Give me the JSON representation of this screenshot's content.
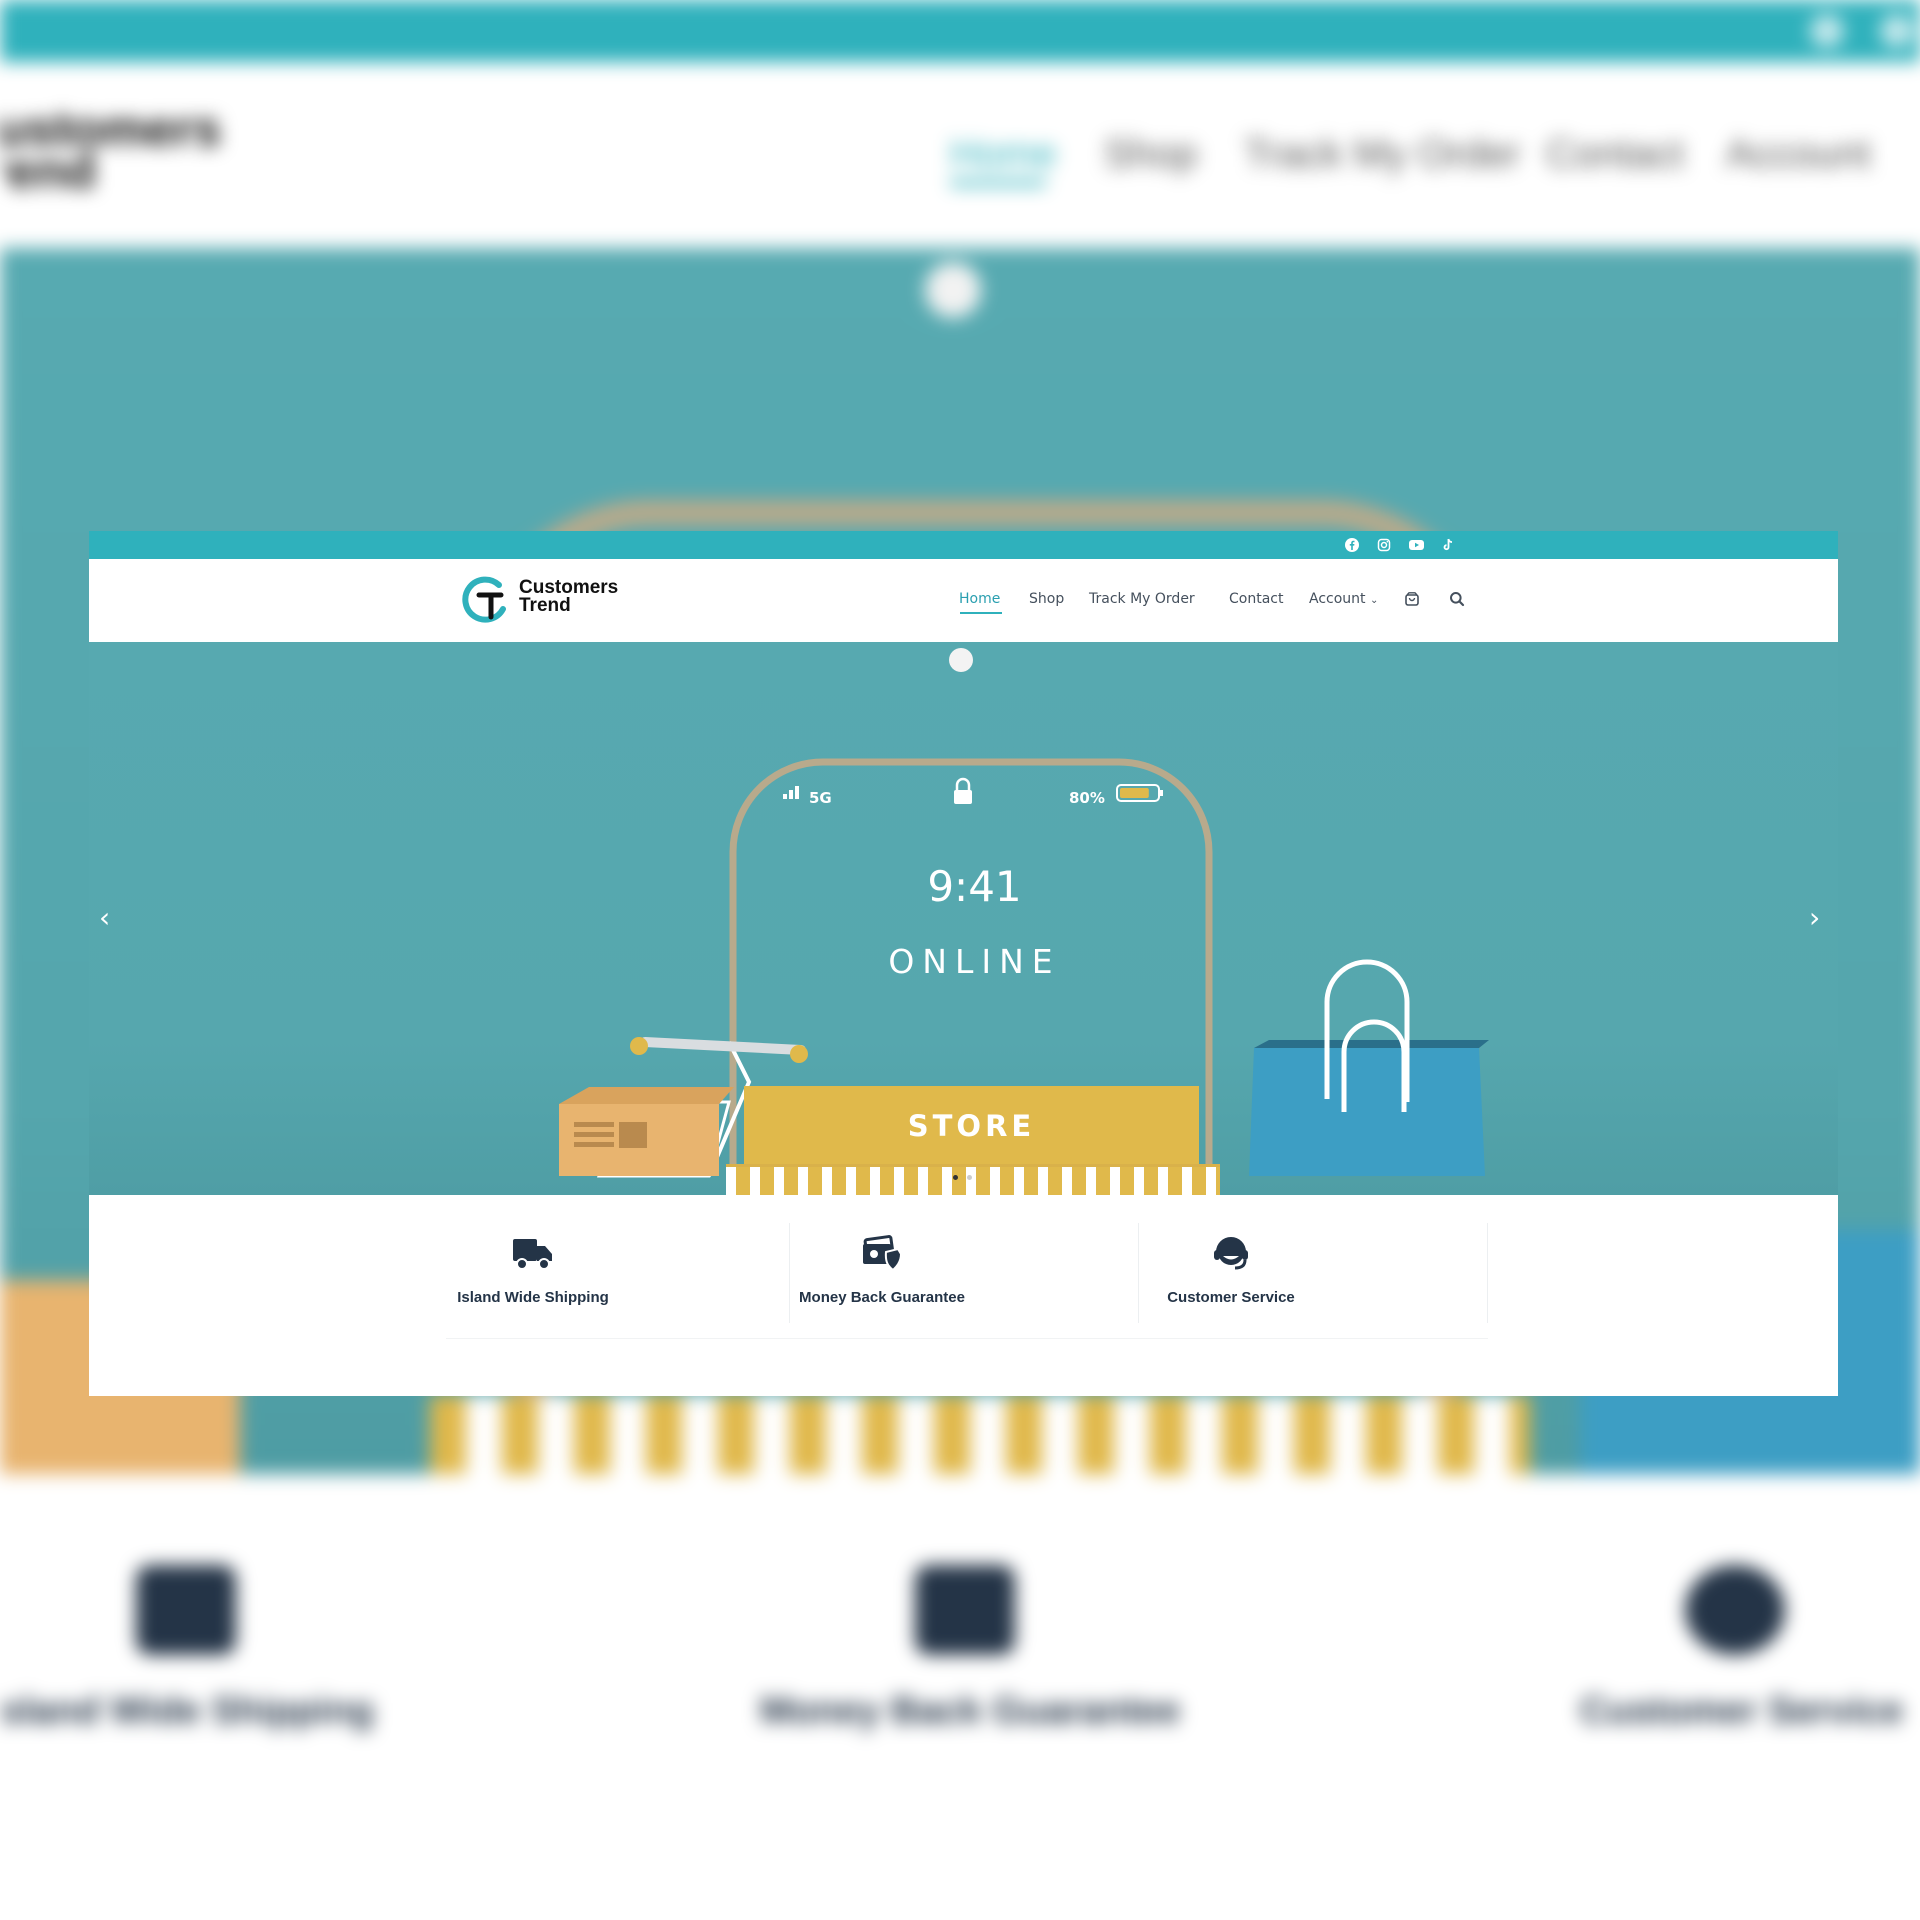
{
  "brand": {
    "line1": "Customers",
    "line2": "Trend",
    "accent": "#2fb1bc",
    "dark": "#243447",
    "gold": "#e0b94b"
  },
  "social": [
    "facebook-icon",
    "instagram-icon",
    "youtube-icon",
    "tiktok-icon"
  ],
  "nav": {
    "items": [
      {
        "label": "Home"
      },
      {
        "label": "Shop"
      },
      {
        "label": "Track My Order"
      },
      {
        "label": "Contact"
      },
      {
        "label": "Account"
      }
    ]
  },
  "hero": {
    "status_signal": "5G",
    "status_battery": "80%",
    "battery_level": 0.8,
    "time": "9:41",
    "headline": "ONLINE",
    "store_sign": "STORE"
  },
  "features": [
    {
      "label": "Island Wide Shipping",
      "icon": "truck-icon"
    },
    {
      "label": "Money Back Guarantee",
      "icon": "money-shield-icon"
    },
    {
      "label": "Customer Service",
      "icon": "headset-icon"
    }
  ]
}
